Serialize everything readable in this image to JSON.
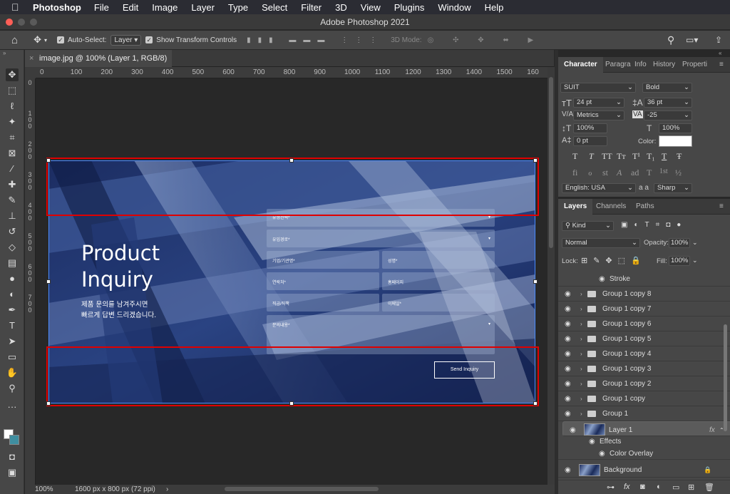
{
  "menu": {
    "apple": "",
    "app": "Photoshop",
    "items": [
      "File",
      "Edit",
      "Image",
      "Layer",
      "Type",
      "Select",
      "Filter",
      "3D",
      "View",
      "Plugins",
      "Window",
      "Help"
    ]
  },
  "window_title": "Adobe Photoshop 2021",
  "options": {
    "auto_select_label": "Auto-Select:",
    "auto_select_value": "Layer",
    "show_transform_label": "Show Transform Controls",
    "mode_3d_label": "3D Mode:"
  },
  "document": {
    "tab_title": "image.jpg @ 100% (Layer 1, RGB/8) *",
    "zoom": "100%",
    "size_info": "1600 px x 800 px (72 ppi)"
  },
  "ruler": {
    "h_ticks": [
      "0",
      "100",
      "200",
      "300",
      "400",
      "500",
      "600",
      "700",
      "800",
      "900",
      "1000",
      "1100",
      "1200",
      "1300",
      "1400",
      "1500",
      "160"
    ],
    "v_ticks": [
      "0",
      "1\n0\n0",
      "2\n0\n0",
      "3\n0\n0",
      "4\n0\n0",
      "5\n0\n0",
      "6\n0\n0",
      "7\n0\n0"
    ]
  },
  "artwork": {
    "title_line1": "Product",
    "title_line2": "Inquiry",
    "subtitle_line1": "제품 문의를 남겨주시면",
    "subtitle_line2": "빠르게 답변 드리겠습니다.",
    "fields": {
      "type": "유형선택*",
      "path": "유입경로*",
      "company": "기업/기관명*",
      "name": "성명*",
      "contact": "연락처*",
      "homepage": "홈페이지",
      "position": "직급/직책",
      "email": "이메일*",
      "message": "문의내용*"
    },
    "send_button": "Send Inquiry"
  },
  "character": {
    "tabs": [
      "Character",
      "Paragra",
      "Info",
      "History",
      "Properti"
    ],
    "font_family": "SUIT",
    "font_style": "Bold",
    "font_size": "24 pt",
    "leading": "36 pt",
    "kerning": "Metrics",
    "tracking": "-25",
    "v_scale": "100%",
    "h_scale": "100%",
    "baseline": "0 pt",
    "color_label": "Color:",
    "color": "#ffffff",
    "language": "English: USA",
    "aa_label": "a a",
    "aa_method": "Sharp",
    "glyphs_row1": [
      "T",
      "T",
      "TT",
      "Tт",
      "T¹",
      "T₁",
      "T",
      "Ŧ"
    ],
    "glyphs_row2": [
      "fi",
      "ℴ",
      "st",
      "A",
      "ad",
      "T",
      "1st",
      "½"
    ]
  },
  "layers": {
    "tabs": [
      "Layers",
      "Channels",
      "Paths"
    ],
    "filter": "Kind",
    "blend": "Normal",
    "opacity_label": "Opacity:",
    "opacity": "100%",
    "lock_label": "Lock:",
    "fill_label": "Fill:",
    "fill": "100%",
    "stroke_label": "Stroke",
    "groups": [
      "Group 1 copy 8",
      "Group 1 copy 7",
      "Group 1 copy 6",
      "Group 1 copy 5",
      "Group 1 copy 4",
      "Group 1 copy 3",
      "Group 1 copy 2",
      "Group 1 copy",
      "Group 1"
    ],
    "layer1": "Layer 1",
    "effects": "Effects",
    "color_overlay": "Color Overlay",
    "background": "Background",
    "fx": "fx"
  }
}
